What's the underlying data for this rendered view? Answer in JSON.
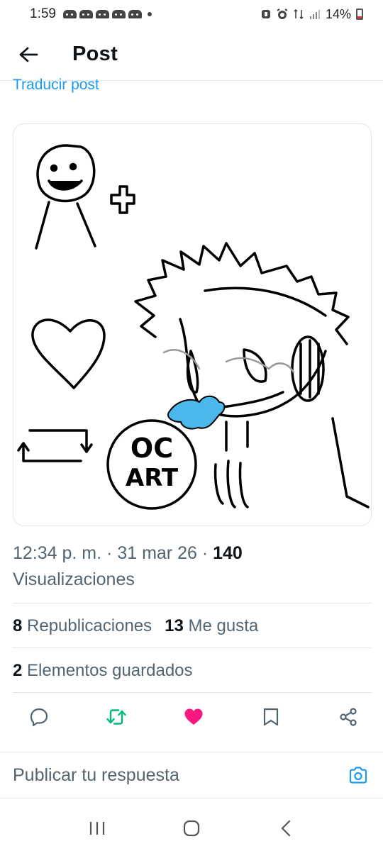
{
  "status_bar": {
    "time": "1:59",
    "battery": "14%",
    "notification_icons": [
      "discord-icon",
      "discord-icon",
      "discord-icon",
      "discord-icon",
      "discord-icon"
    ]
  },
  "header": {
    "title": "Post"
  },
  "post": {
    "translate_label": "Traducir post",
    "time": "12:34 p. m.",
    "date": "31 mar 26",
    "views_count": "140",
    "views_label": "Visualizaciones",
    "image_text": "OC ART"
  },
  "stats": {
    "reposts_count": "8",
    "reposts_label": "Republicaciones",
    "likes_count": "13",
    "likes_label": "Me gusta",
    "bookmarks_count": "2",
    "bookmarks_label": "Elementos guardados"
  },
  "actions": [
    "reply-icon",
    "repost-icon",
    "like-icon",
    "bookmark-icon",
    "share-icon"
  ],
  "colors": {
    "accent": "#1d9bf0",
    "repost": "#00ba7c",
    "like": "#f91880",
    "secondary_text": "#536471"
  },
  "reply_bar": {
    "placeholder": "Publicar tu respuesta"
  }
}
